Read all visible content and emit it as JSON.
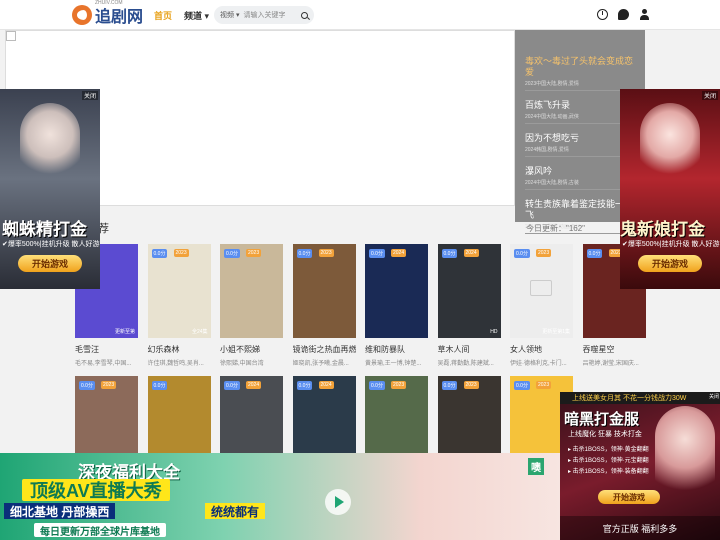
{
  "header": {
    "logo_text": "追剧网",
    "logo_sub": "ZHUIV.COM",
    "nav": {
      "home": "首页",
      "channel": "频道 ▾"
    },
    "search": {
      "select": "视频 ▾",
      "placeholder": "请输入关键字"
    }
  },
  "right_list": [
    {
      "title": "毒欢～毒过了头就会变成恋爱",
      "sub": "2023中国大陆,剧情,爱情",
      "active": true
    },
    {
      "title": "百炼飞升录",
      "sub": "2024中国大陆,动画,武侠",
      "active": false
    },
    {
      "title": "因为不想吃亏",
      "sub": "2024韩国,剧情,爱情",
      "active": false
    },
    {
      "title": "瀑风吟",
      "sub": "2024中国大陆,剧情,古装",
      "active": false
    },
    {
      "title": "转生贵族靠着鉴定技能一路飞",
      "sub": "2024日本,剧情,动画,奇幻",
      "active": false
    }
  ],
  "section": {
    "title": "片推荐",
    "update": "今日更新：\"162\""
  },
  "row1": [
    {
      "title": "毛雪汪",
      "sub": "毛不易,李雪琴,中国...",
      "badge_l": "0.0分",
      "badge_r": "",
      "corner": "更新至第",
      "color": "#5b4bd1"
    },
    {
      "title": "幻乐森林",
      "sub": "许佳琪,魏哲鸣,吴肖...",
      "badge_l": "0.0分",
      "badge_r": "2023",
      "corner": "全24集",
      "color": "#e8e2d0"
    },
    {
      "title": "小姐不熙娣",
      "sub": "徐熙娣,中国台湾",
      "badge_l": "0.0分",
      "badge_r": "2023",
      "corner": "",
      "color": "#c9b89a"
    },
    {
      "title": "镜诡街之热血再燃",
      "sub": "姬晓凯,张予曦,金晨...",
      "badge_l": "0.0分",
      "badge_r": "2023",
      "corner": "",
      "color": "#7d5a3a"
    },
    {
      "title": "维和防暴队",
      "sub": "黄景瑜,王一博,钟楚...",
      "badge_l": "0.0分",
      "badge_r": "2024",
      "corner": "",
      "color": "#1a2a55"
    },
    {
      "title": "草木人间",
      "sub": "吴磊,蒋勤勤,陈建斌...",
      "badge_l": "0.0分",
      "badge_r": "2024",
      "corner": "HD",
      "color": "#2f3338"
    },
    {
      "title": "女人领地",
      "sub": "伊娃·德格利克,卡门...",
      "badge_l": "0.0分",
      "badge_r": "2023",
      "corner": "更新至第1集",
      "color": "#ededed"
    },
    {
      "title": "吞噬星空",
      "sub": "吕艳婷,谢莹,宋国庆...",
      "badge_l": "0.0分",
      "badge_r": "2023",
      "corner": "",
      "color": "#6a2420"
    }
  ],
  "row2": [
    {
      "badge_l": "0.0分",
      "badge_r": "2023",
      "color": "#8c6a5a"
    },
    {
      "badge_l": "0.0分",
      "badge_r": "",
      "color": "#b38a2e"
    },
    {
      "badge_l": "0.0分",
      "badge_r": "2024",
      "color": "#4a4d52"
    },
    {
      "badge_l": "0.0分",
      "badge_r": "2024",
      "color": "#2b3b4a"
    },
    {
      "badge_l": "0.0分",
      "badge_r": "2023",
      "color": "#556a4a"
    },
    {
      "badge_l": "0.0分",
      "badge_r": "2023",
      "color": "#3a3530"
    },
    {
      "badge_l": "0.0分",
      "badge_r": "2023",
      "color": "#f5c23a"
    }
  ],
  "ad_left": {
    "close": "关闭",
    "headline": "蜘蛛精打金",
    "line": "✔爆率500%|挂机升级 散人好游✔",
    "button": "开始游戏"
  },
  "ad_right": {
    "close": "关闭",
    "headline": "鬼新娘打金",
    "line": "✔爆率500%|挂机升级 散人好游✔",
    "button": "开始游戏"
  },
  "ad_bottom": {
    "line1": "深夜福利大全",
    "line2": "顶级AV直播大秀",
    "line3a": "细北基地 丹部操西",
    "line3b": "统统都有",
    "line4": "每日更新万部全球片库基地",
    "tag": "噢"
  },
  "ad_br": {
    "top": "上线送美女月其 不花一分钱战力30W",
    "close": "关闭",
    "title": "暗黑打金服",
    "sub": "上线魔化 狂暴 技术打金",
    "lines": [
      "▸ 击杀1BOSS，领神·黄金翻翻",
      "▸ 击杀1BOSS，领神·元宝翻翻",
      "▸ 击杀1BOSS，领神·装备翻翻"
    ],
    "button": "开始游戏",
    "foot": "官方正版 福利多多"
  },
  "colors": {
    "accent": "#e8a21b",
    "brand": "#2a4d8f",
    "rightlist_bg": "#8a8a8a"
  }
}
